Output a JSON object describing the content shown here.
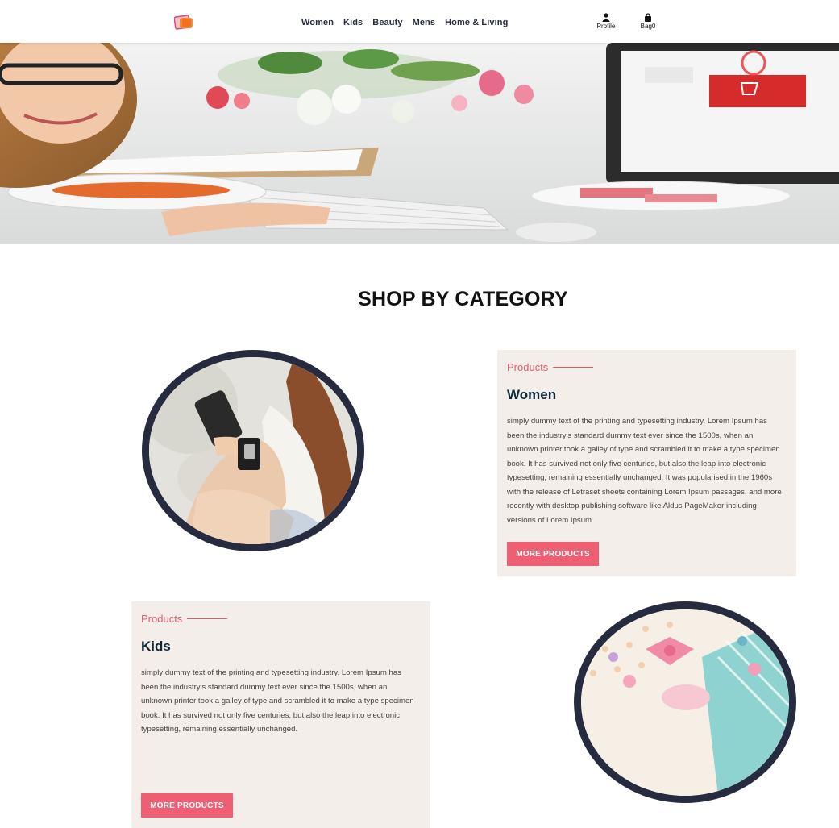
{
  "header": {
    "nav": [
      "Women",
      "Kids",
      "Beauty",
      "Mens",
      "Home & Living"
    ],
    "profile_label": "Profile",
    "bag_label": "Bag0"
  },
  "section": {
    "title": "SHOP BY CATEGORY"
  },
  "categories": [
    {
      "eyebrow": "Products",
      "title": "Women",
      "description": "simply dummy text of the printing and typesetting industry. Lorem Ipsum has been the industry's standard dummy text ever since the 1500s, when an unknown printer took a galley of type and scrambled it to make a type specimen book. It has survived not only five centuries, but also the leap into electronic typesetting, remaining essentially unchanged. It was popularised in the 1960s with the release of Letraset sheets containing Lorem Ipsum passages, and more recently with desktop publishing software like Aldus PageMaker including versions of Lorem Ipsum.",
      "button": "MORE PRODUCTS"
    },
    {
      "eyebrow": "Products",
      "title": "Kids",
      "description": "simply dummy text of the printing and typesetting industry. Lorem Ipsum has been the industry's standard dummy text ever since the 1500s, when an unknown printer took a galley of type and scrambled it to make a type specimen book. It has survived not only five centuries, but also the leap into electronic typesetting, remaining essentially unchanged.",
      "button": "MORE PRODUCTS"
    }
  ],
  "colors": {
    "accent": "#ee5f74",
    "card_bg": "#f4eeea",
    "circle_border": "#262b40"
  }
}
